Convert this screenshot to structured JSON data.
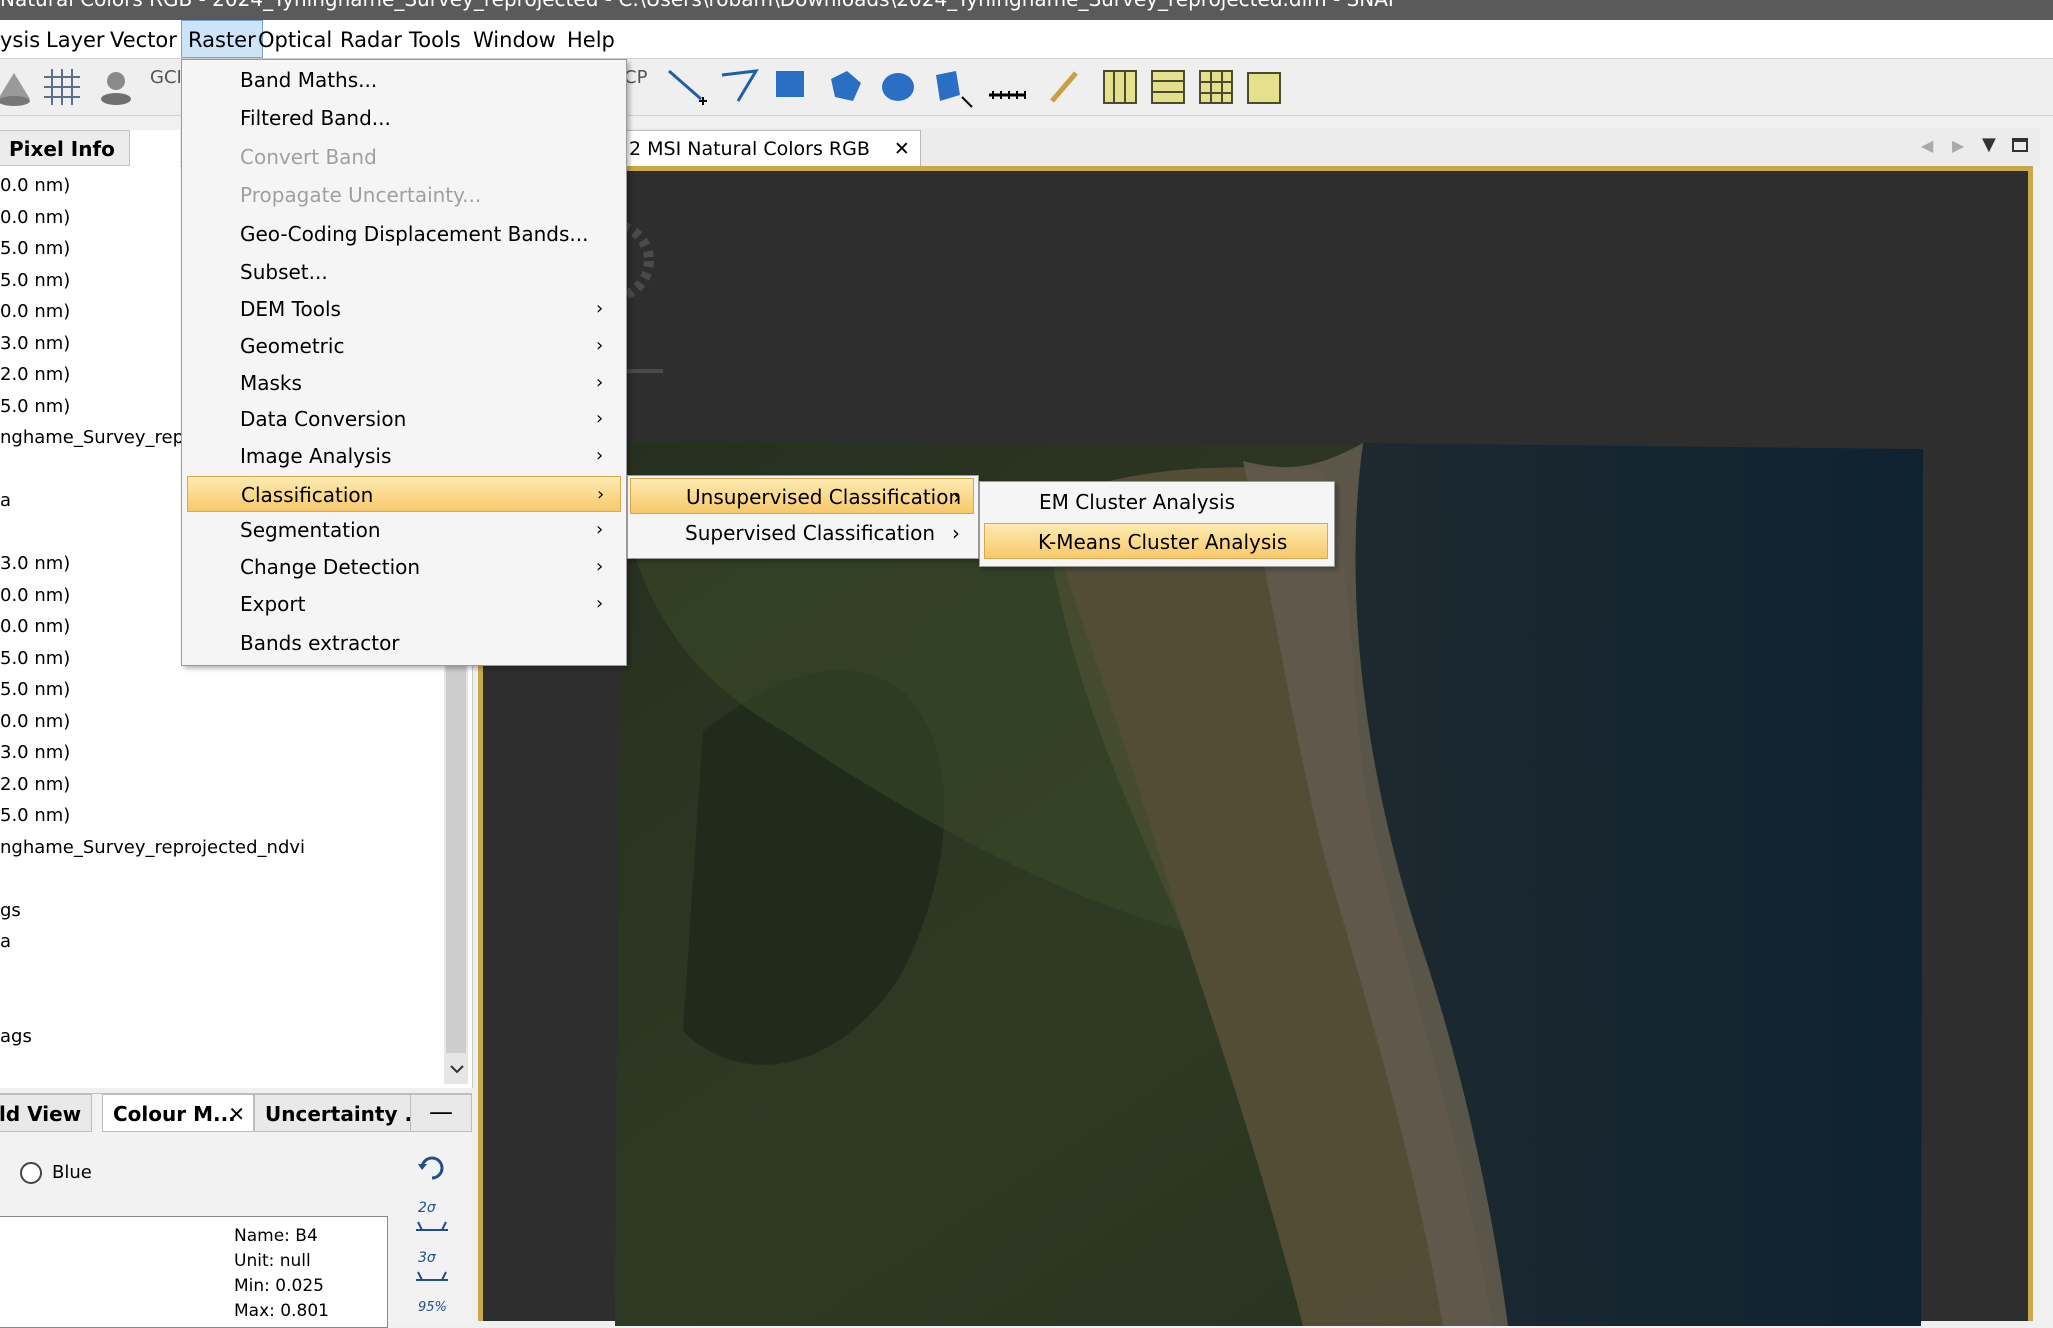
{
  "window": {
    "title": "Natural Colors RGB - 2024_Tyninghame_Survey_reprojected - C:\\Users\\robam\\Downloads\\2024_Tyninghame_Survey_reprojected.dim - SNAP"
  },
  "menubar": {
    "items": [
      "ysis",
      "Layer",
      "Vector",
      "Raster",
      "Optical",
      "Radar",
      "Tools",
      "Window",
      "Help"
    ],
    "active": "Raster"
  },
  "toolbar": {
    "partial_label": "GCI",
    "gcp_label": "CP"
  },
  "left_panel": {
    "tab_label": "Pixel Info",
    "lines": [
      "0.0 nm)",
      "0.0 nm)",
      "5.0 nm)",
      "5.0 nm)",
      "0.0 nm)",
      "3.0 nm)",
      "2.0 nm)",
      "5.0 nm)",
      "nghame_Survey_repro",
      "a",
      "3.0 nm)",
      "0.0 nm)",
      "0.0 nm)",
      "5.0 nm)",
      "5.0 nm)",
      "0.0 nm)",
      "3.0 nm)",
      "2.0 nm)",
      "5.0 nm)",
      "nghame_Survey_reprojected_ndvi",
      "gs",
      "a",
      "ags"
    ]
  },
  "bottom_panel": {
    "tabs": [
      "ld View",
      "Colour M...",
      "Uncertainty ..."
    ],
    "radio_label": "Blue",
    "band_info": [
      "Name: B4",
      "Unit: null",
      "Min: 0.025",
      "Max: 0.801"
    ],
    "sigma_labels": [
      "2σ",
      "3σ",
      "95%"
    ]
  },
  "viewer": {
    "tab_label": "2 MSI Natural Colors RGB"
  },
  "raster_menu": {
    "items": [
      {
        "label": "Band Maths...",
        "submenu": false,
        "disabled": false
      },
      {
        "label": "Filtered Band...",
        "submenu": false,
        "disabled": false
      },
      {
        "label": "Convert Band",
        "submenu": false,
        "disabled": true
      },
      {
        "label": "Propagate Uncertainty...",
        "submenu": false,
        "disabled": true
      },
      {
        "label": "Geo-Coding Displacement Bands...",
        "submenu": false,
        "disabled": false
      },
      {
        "label": "Subset...",
        "submenu": false,
        "disabled": false
      },
      {
        "label": "DEM Tools",
        "submenu": true,
        "disabled": false
      },
      {
        "label": "Geometric",
        "submenu": true,
        "disabled": false
      },
      {
        "label": "Masks",
        "submenu": true,
        "disabled": false
      },
      {
        "label": "Data Conversion",
        "submenu": true,
        "disabled": false
      },
      {
        "label": "Image Analysis",
        "submenu": true,
        "disabled": false
      },
      {
        "label": "Classification",
        "submenu": true,
        "disabled": false,
        "highlighted": true
      },
      {
        "label": "Segmentation",
        "submenu": true,
        "disabled": false
      },
      {
        "label": "Change Detection",
        "submenu": true,
        "disabled": false
      },
      {
        "label": "Export",
        "submenu": true,
        "disabled": false
      },
      {
        "label": "Bands extractor",
        "submenu": false,
        "disabled": false
      }
    ]
  },
  "classification_submenu": {
    "items": [
      "Unsupervised Classification",
      "Supervised Classification"
    ],
    "highlighted": "Unsupervised Classification"
  },
  "unsupervised_submenu": {
    "items": [
      "EM Cluster Analysis",
      "K-Means Cluster Analysis"
    ],
    "highlighted": "K-Means Cluster Analysis"
  },
  "colors": {
    "menu_highlight": "#f7c96b",
    "viewer_border": "#c9a84a",
    "viewer_background": "#2e2e2e"
  }
}
